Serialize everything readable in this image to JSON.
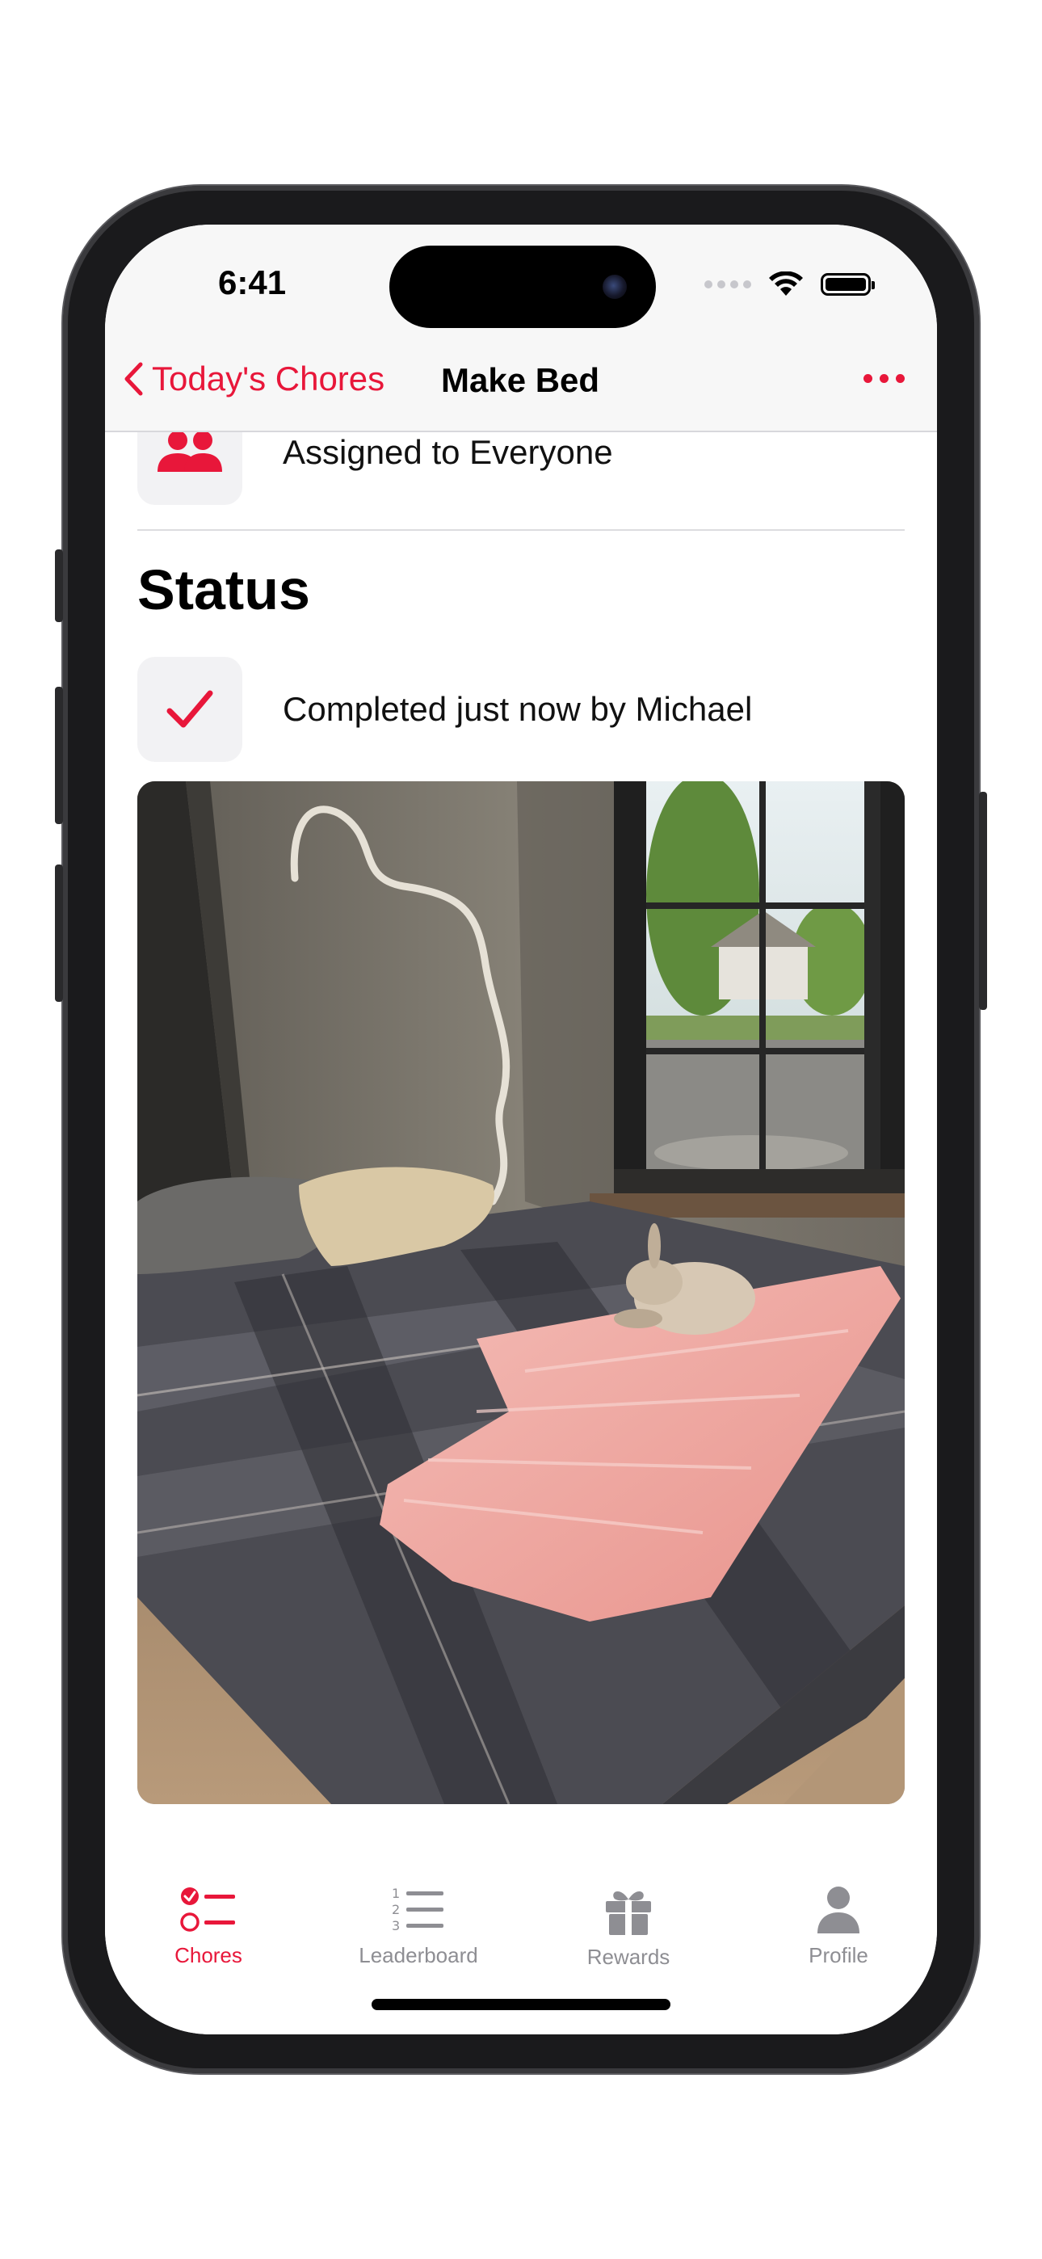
{
  "status_bar": {
    "time": "6:41",
    "icons": [
      "cellular-icon",
      "wifi-icon",
      "battery-icon"
    ]
  },
  "navigation": {
    "back_label": "Today's Chores",
    "title": "Make Bed",
    "more_icon": "ellipsis-icon"
  },
  "assignment": {
    "icon": "people-icon",
    "text": "Assigned to Everyone"
  },
  "status": {
    "heading": "Status",
    "icon": "checkmark-icon",
    "text": "Completed just now by Michael"
  },
  "photo": {
    "description": "bedroom-photo"
  },
  "tabs": [
    {
      "label": "Chores",
      "icon": "checklist-icon",
      "active": true
    },
    {
      "label": "Leaderboard",
      "icon": "numbered-list-icon",
      "active": false
    },
    {
      "label": "Rewards",
      "icon": "gift-icon",
      "active": false
    },
    {
      "label": "Profile",
      "icon": "person-icon",
      "active": false
    }
  ],
  "colors": {
    "accent": "#e8173a",
    "inactive": "#8e8e93",
    "tile_bg": "#f2f2f4"
  }
}
